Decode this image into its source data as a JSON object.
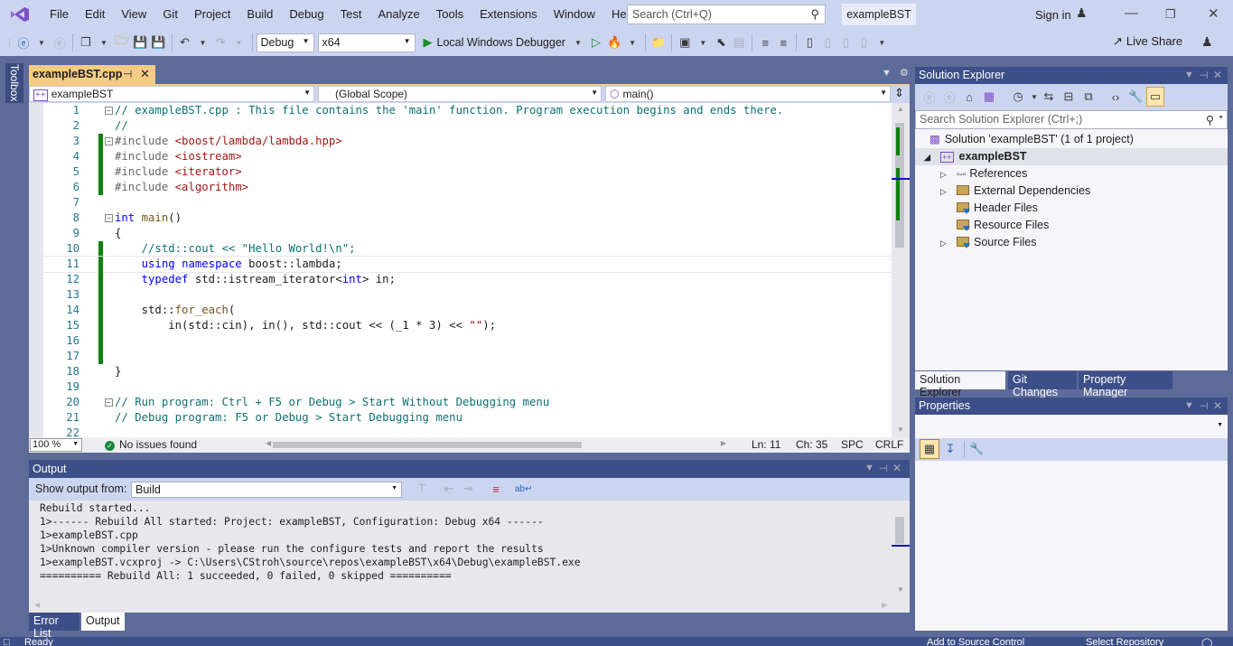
{
  "titlebar": {
    "menu": [
      "File",
      "Edit",
      "View",
      "Git",
      "Project",
      "Build",
      "Debug",
      "Test",
      "Analyze",
      "Tools",
      "Extensions",
      "Window",
      "Help"
    ],
    "search_placeholder": "Search (Ctrl+Q)",
    "project_title": "exampleBST",
    "sign_in": "Sign in"
  },
  "toolbar": {
    "configuration": "Debug",
    "platform": "x64",
    "run_target": "Local Windows Debugger",
    "live_share": "Live Share"
  },
  "sidebar": {
    "toolbox": "Toolbox"
  },
  "editor": {
    "tab_label": "exampleBST.cpp",
    "nav_project": "exampleBST",
    "nav_scope": "(Global Scope)",
    "nav_member": "main()",
    "lines": [
      {
        "n": "1",
        "html": "<span class='cmt'>// exampleBST.cpp : This file contains the 'main' function. Program execution begins and ends there.</span>"
      },
      {
        "n": "2",
        "html": "<span class='cmt'>//</span>"
      },
      {
        "n": "3",
        "html": "<span class='pp'>#include</span> <span class='str'>&lt;boost/lambda/lambda.hpp&gt;</span>"
      },
      {
        "n": "4",
        "html": "<span class='pp'>#include</span> <span class='str'>&lt;iostream&gt;</span>"
      },
      {
        "n": "5",
        "html": "<span class='pp'>#include</span> <span class='str'>&lt;iterator&gt;</span>"
      },
      {
        "n": "6",
        "html": "<span class='pp'>#include</span> <span class='str'>&lt;algorithm&gt;</span>"
      },
      {
        "n": "7",
        "html": ""
      },
      {
        "n": "8",
        "html": "<span class='kw'>int</span> <span class='fn'>main</span>()"
      },
      {
        "n": "9",
        "html": "{"
      },
      {
        "n": "10",
        "html": "    <span class='cmt'>//std::cout &lt;&lt; \"Hello World!\\n\";</span>"
      },
      {
        "n": "11",
        "html": "    <span class='kw'>using</span> <span class='kw'>namespace</span> boost::lambda;"
      },
      {
        "n": "12",
        "html": "    <span class='kw'>typedef</span> std::istream_iterator&lt;<span class='kw'>int</span>&gt; in;"
      },
      {
        "n": "13",
        "html": ""
      },
      {
        "n": "14",
        "html": "    std::<span class='fn'>for_each</span>("
      },
      {
        "n": "15",
        "html": "        in(std::cin), in(), std::cout &lt;&lt; (_1 * 3) &lt;&lt; <span class='str'>\"\"</span>);"
      },
      {
        "n": "16",
        "html": ""
      },
      {
        "n": "17",
        "html": ""
      },
      {
        "n": "18",
        "html": "}"
      },
      {
        "n": "19",
        "html": ""
      },
      {
        "n": "20",
        "html": "<span class='cmt'>// Run program: Ctrl + F5 or Debug &gt; Start Without Debugging menu</span>"
      },
      {
        "n": "21",
        "html": "<span class='cmt'>// Debug program: F5 or Debug &gt; Start Debugging menu</span>"
      },
      {
        "n": "22",
        "html": ""
      }
    ],
    "status": {
      "zoom": "100 %",
      "issues": "No issues found",
      "line": "Ln: 11",
      "col": "Ch: 35",
      "spacing": "SPC",
      "eol": "CRLF"
    }
  },
  "output": {
    "title": "Output",
    "show_from_label": "Show output from:",
    "source": "Build",
    "lines": [
      "Rebuild started...",
      "1>------ Rebuild All started: Project: exampleBST, Configuration: Debug x64 ------",
      "1>exampleBST.cpp",
      "1>Unknown compiler version - please run the configure tests and report the results",
      "1>exampleBST.vcxproj -> C:\\Users\\CStroh\\source\\repos\\exampleBST\\x64\\Debug\\exampleBST.exe",
      "========== Rebuild All: 1 succeeded, 0 failed, 0 skipped =========="
    ],
    "tabs": [
      "Error List",
      "Output"
    ]
  },
  "solution_explorer": {
    "title": "Solution Explorer",
    "search_placeholder": "Search Solution Explorer (Ctrl+;)",
    "solution": "Solution 'exampleBST' (1 of 1 project)",
    "project": "exampleBST",
    "items": [
      "References",
      "External Dependencies",
      "Header Files",
      "Resource Files",
      "Source Files"
    ],
    "tabs": [
      "Solution Explorer",
      "Git Changes",
      "Property Manager"
    ]
  },
  "properties": {
    "title": "Properties"
  },
  "statusbar": {
    "left": "Ready",
    "source_control": "Add to Source Control",
    "repo": "Select Repository"
  }
}
